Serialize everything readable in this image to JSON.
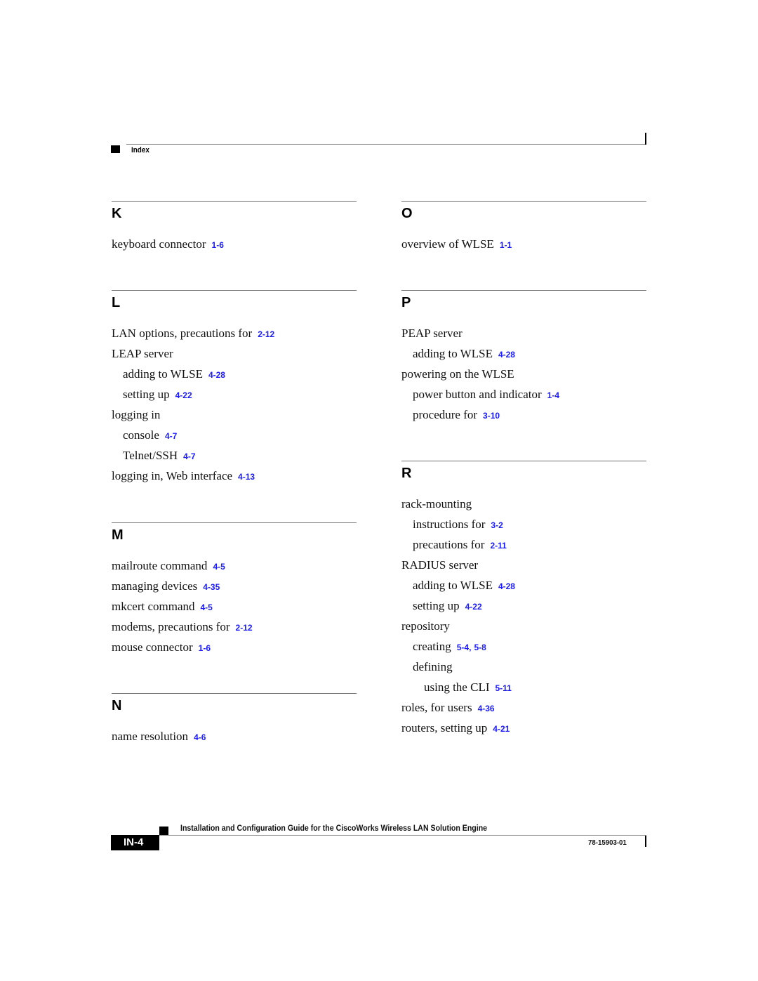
{
  "header": {
    "section_label": "Index"
  },
  "columns": [
    {
      "sections": [
        {
          "letter": "K",
          "entries": [
            {
              "level": 0,
              "text": "keyboard connector",
              "pages": [
                "1-6"
              ]
            }
          ]
        },
        {
          "letter": "L",
          "entries": [
            {
              "level": 0,
              "text": "LAN options, precautions for",
              "pages": [
                "2-12"
              ]
            },
            {
              "level": 0,
              "text": "LEAP server",
              "pages": []
            },
            {
              "level": 1,
              "text": "adding to WLSE",
              "pages": [
                "4-28"
              ]
            },
            {
              "level": 1,
              "text": "setting up",
              "pages": [
                "4-22"
              ]
            },
            {
              "level": 0,
              "text": "logging in",
              "pages": []
            },
            {
              "level": 1,
              "text": "console",
              "pages": [
                "4-7"
              ]
            },
            {
              "level": 1,
              "text": "Telnet/SSH",
              "pages": [
                "4-7"
              ]
            },
            {
              "level": 0,
              "text": "logging in, Web interface",
              "pages": [
                "4-13"
              ]
            }
          ]
        },
        {
          "letter": "M",
          "entries": [
            {
              "level": 0,
              "text": "mailroute command",
              "pages": [
                "4-5"
              ]
            },
            {
              "level": 0,
              "text": "managing devices",
              "pages": [
                "4-35"
              ]
            },
            {
              "level": 0,
              "text": "mkcert command",
              "pages": [
                "4-5"
              ]
            },
            {
              "level": 0,
              "text": "modems, precautions for",
              "pages": [
                "2-12"
              ]
            },
            {
              "level": 0,
              "text": "mouse connector",
              "pages": [
                "1-6"
              ]
            }
          ]
        },
        {
          "letter": "N",
          "entries": [
            {
              "level": 0,
              "text": "name resolution",
              "pages": [
                "4-6"
              ]
            }
          ]
        }
      ]
    },
    {
      "sections": [
        {
          "letter": "O",
          "entries": [
            {
              "level": 0,
              "text": "overview of WLSE",
              "pages": [
                "1-1"
              ]
            }
          ]
        },
        {
          "letter": "P",
          "entries": [
            {
              "level": 0,
              "text": "PEAP server",
              "pages": []
            },
            {
              "level": 1,
              "text": "adding to WLSE",
              "pages": [
                "4-28"
              ]
            },
            {
              "level": 0,
              "text": "powering on the WLSE",
              "pages": []
            },
            {
              "level": 1,
              "text": "power button and indicator",
              "pages": [
                "1-4"
              ]
            },
            {
              "level": 1,
              "text": "procedure for",
              "pages": [
                "3-10"
              ]
            }
          ]
        },
        {
          "letter": "R",
          "entries": [
            {
              "level": 0,
              "text": "rack-mounting",
              "pages": []
            },
            {
              "level": 1,
              "text": "instructions for",
              "pages": [
                "3-2"
              ]
            },
            {
              "level": 1,
              "text": "precautions for",
              "pages": [
                "2-11"
              ]
            },
            {
              "level": 0,
              "text": "RADIUS server",
              "pages": []
            },
            {
              "level": 1,
              "text": "adding to WLSE",
              "pages": [
                "4-28"
              ]
            },
            {
              "level": 1,
              "text": "setting up",
              "pages": [
                "4-22"
              ]
            },
            {
              "level": 0,
              "text": "repository",
              "pages": []
            },
            {
              "level": 1,
              "text": "creating",
              "pages": [
                "5-4",
                "5-8"
              ]
            },
            {
              "level": 1,
              "text": "defining",
              "pages": []
            },
            {
              "level": 2,
              "text": "using the CLI",
              "pages": [
                "5-11"
              ]
            },
            {
              "level": 0,
              "text": "roles, for users",
              "pages": [
                "4-36"
              ]
            },
            {
              "level": 0,
              "text": "routers, setting up",
              "pages": [
                "4-21"
              ]
            }
          ]
        }
      ]
    }
  ],
  "footer": {
    "guide_title": "Installation and Configuration Guide for the CiscoWorks Wireless LAN Solution Engine",
    "page_number": "IN-4",
    "doc_number": "78-15903-01"
  },
  "colors": {
    "link": "#1a1aff",
    "text": "#111111"
  }
}
